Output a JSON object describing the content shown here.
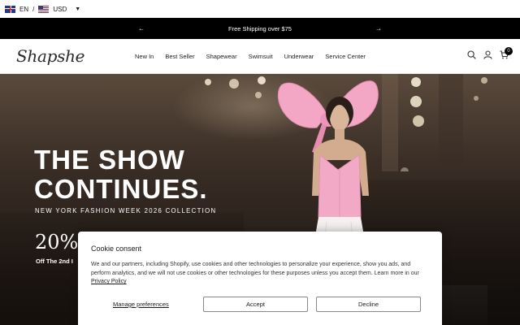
{
  "locale": {
    "language": "EN",
    "separator": "/",
    "currency": "USD",
    "caret": "▼"
  },
  "announcement": {
    "text": "Free Shipping over $75",
    "prev": "←",
    "next": "→"
  },
  "header": {
    "logo": "Shapshe",
    "nav": [
      "New In",
      "Best Seller",
      "Shapewear",
      "Swimsuit",
      "Underwear",
      "Service Center"
    ],
    "cart_count": "0"
  },
  "hero": {
    "title_line1": "THE SHOW",
    "title_line2": "CONTINUES.",
    "subtitle": "NEW YORK FASHION WEEK 2026 COLLECTION",
    "promo_percent": "20%",
    "promo_text": "Off The 2nd I"
  },
  "cookie": {
    "title": "Cookie consent",
    "body": "We and our partners, including Shopify, use cookies and other technologies to personalize your experience, show you ads, and perform analytics, and we will not use cookies or other technologies for these purposes unless you accept them. Learn more in our ",
    "privacy_link": "Privacy Policy",
    "manage_label": "Manage preferences",
    "accept_label": "Accept",
    "decline_label": "Decline"
  },
  "colors": {
    "announcement_bg": "#000000",
    "accent_pink": "#f3a7c4"
  }
}
